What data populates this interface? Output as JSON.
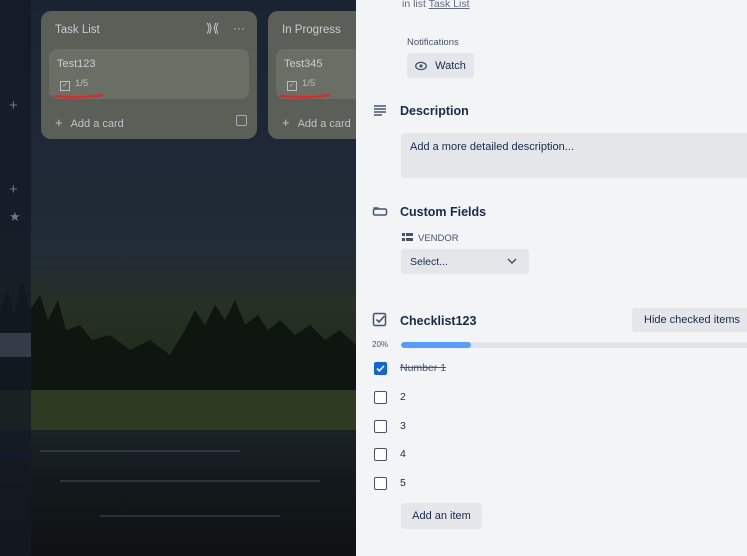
{
  "board": {
    "lists": [
      {
        "title": "Task List",
        "card_title": "Test123",
        "badge": "1/5",
        "add_card": "Add a card"
      },
      {
        "title": "In Progress",
        "card_title": "Test345",
        "badge": "1/5",
        "add_card": "Add a card"
      }
    ]
  },
  "card_detail": {
    "in_list_prefix": "in list",
    "in_list_link": "Task List",
    "notifications_label": "Notifications",
    "watch_label": "Watch",
    "description_title": "Description",
    "description_placeholder": "Add a more detailed description...",
    "custom_fields_title": "Custom Fields",
    "vendor_label": "VENDOR",
    "vendor_select": "Select...",
    "checklist": {
      "title": "Checklist123",
      "hide_checked_label": "Hide checked items",
      "progress_text": "20%",
      "progress": 0.2,
      "items": [
        {
          "text": "Number 1",
          "checked": true
        },
        {
          "text": "2",
          "checked": false
        },
        {
          "text": "3",
          "checked": false
        },
        {
          "text": "4",
          "checked": false
        },
        {
          "text": "5",
          "checked": false
        }
      ],
      "add_item_label": "Add an item"
    }
  },
  "colors": {
    "accent": "#0c66e4",
    "progress": "#579dff",
    "annotation": "#e0262e"
  }
}
